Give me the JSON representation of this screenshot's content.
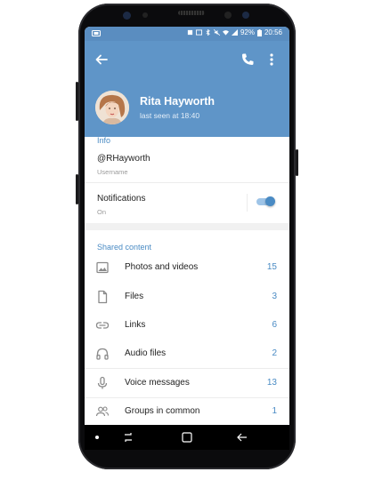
{
  "status_bar": {
    "battery": "92%",
    "time": "20:56"
  },
  "header": {
    "name": "Rita Hayworth",
    "last_seen": "last seen at 18:40",
    "icons": [
      "back-arrow-icon",
      "phone-icon",
      "more-vert-icon"
    ]
  },
  "info": {
    "section_title": "Info",
    "username_value": "@RHayworth",
    "username_caption": "Username",
    "notifications_label": "Notifications",
    "notifications_state": "On",
    "notifications_enabled": true
  },
  "shared": {
    "section_title": "Shared content",
    "items": [
      {
        "label": "Photos and videos",
        "count": "15",
        "icon": "image-icon"
      },
      {
        "label": "Files",
        "count": "3",
        "icon": "file-icon"
      },
      {
        "label": "Links",
        "count": "6",
        "icon": "link-icon"
      },
      {
        "label": "Audio files",
        "count": "2",
        "icon": "headphones-icon"
      },
      {
        "label": "Voice messages",
        "count": "13",
        "icon": "microphone-icon"
      },
      {
        "label": "Groups in common",
        "count": "1",
        "icon": "group-icon"
      }
    ]
  },
  "colors": {
    "header_blue": "#5f95c8",
    "accent": "#4a8bc4"
  }
}
